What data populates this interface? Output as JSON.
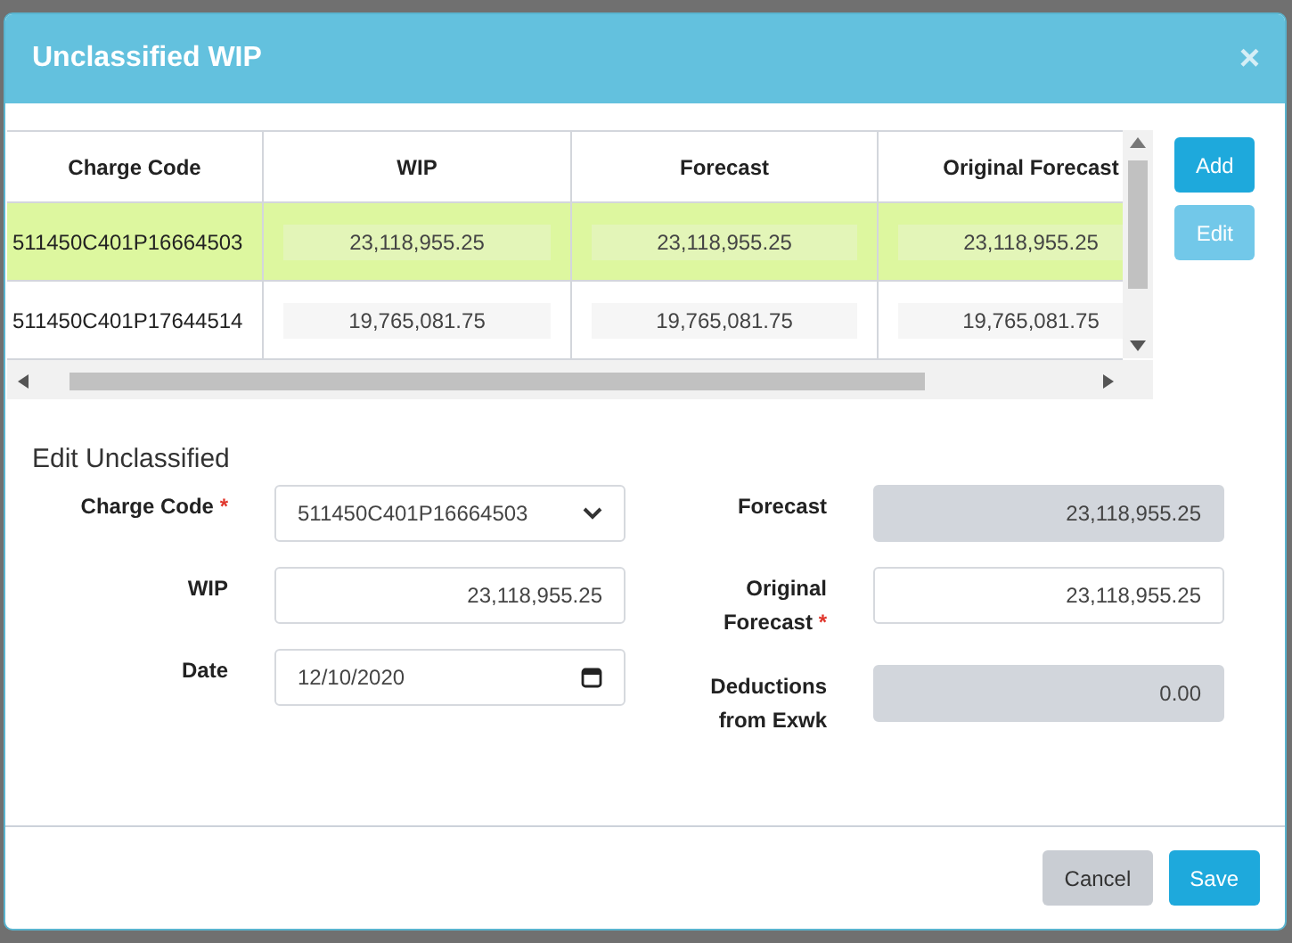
{
  "window": {
    "title": "Unclassified WIP",
    "close": "×"
  },
  "table": {
    "columns": [
      "Charge Code",
      "WIP",
      "Forecast",
      "Original Forecast"
    ],
    "rows": [
      {
        "selected": true,
        "cells": [
          "511450C401P16664503",
          "23,118,955.25",
          "23,118,955.25",
          "23,118,955.25"
        ]
      },
      {
        "selected": false,
        "cells": [
          "511450C401P17644514",
          "19,765,081.75",
          "19,765,081.75",
          "19,765,081.75"
        ]
      }
    ]
  },
  "side_buttons": [
    {
      "label": "Add",
      "disabled": false
    },
    {
      "label": "Edit",
      "disabled": true
    }
  ],
  "form": {
    "title": "Edit Unclassified",
    "required_mark": "*",
    "left": [
      {
        "label": "Charge Code",
        "required": true,
        "kind": "select",
        "value": "511450C401P16664503"
      },
      {
        "label": "WIP",
        "required": false,
        "kind": "text",
        "value": "23,118,955.25"
      },
      {
        "label": "Date",
        "required": false,
        "kind": "date",
        "value": "12/10/2020"
      }
    ],
    "right": [
      {
        "label": "Forecast",
        "required": false,
        "kind": "readonly",
        "value": "23,118,955.25"
      },
      {
        "label": "Original Forecast",
        "required": true,
        "kind": "text",
        "value": "23,118,955.25"
      },
      {
        "label": "Deductions from Exwk",
        "required": false,
        "kind": "readonly",
        "value": "0.00"
      }
    ]
  },
  "footer_buttons": [
    {
      "label": "Cancel",
      "kind": "secondary"
    },
    {
      "label": "Save",
      "kind": "primary"
    }
  ]
}
